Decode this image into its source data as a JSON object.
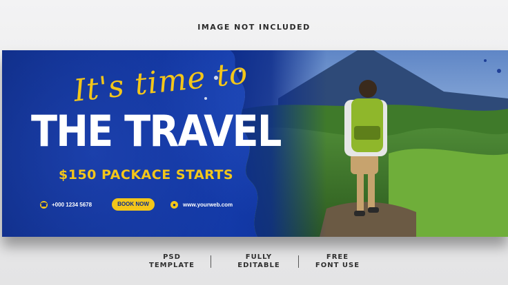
{
  "header": {
    "note": "IMAGE NOT INCLUDED"
  },
  "banner": {
    "script_title": "It's time to",
    "main_title": "THE TRAVEL",
    "price_line": "$150 PACKACE STARTS",
    "phone": "+000 1234 5678",
    "book_button": "BOOK NOW",
    "website": "www.yourweb.com",
    "accent_color": "#f3c61a",
    "brand_blue": "#0c2b8a"
  },
  "features": [
    {
      "line1": "PSD",
      "line2": "TEMPLATE"
    },
    {
      "line1": "FULLY",
      "line2": "EDITABLE"
    },
    {
      "line1": "FREE",
      "line2": "FONT USE"
    }
  ],
  "icons": [
    "phone-icon",
    "globe-icon"
  ]
}
